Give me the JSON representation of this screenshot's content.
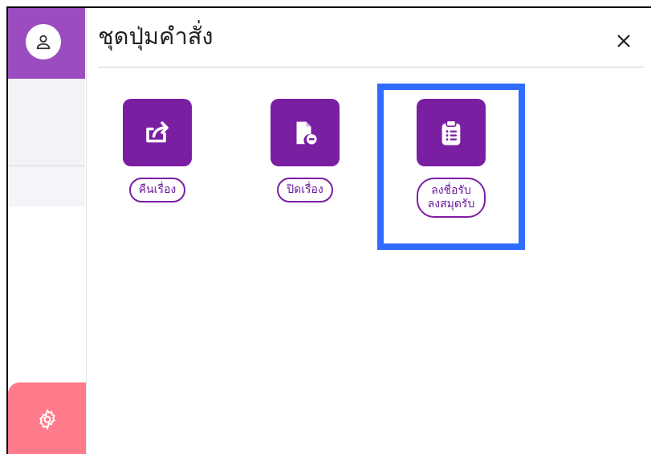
{
  "panel": {
    "title": "ชุดปุ่มคำสั่ง",
    "close_label": "×"
  },
  "commands": [
    {
      "label": "คืนเรื่อง",
      "icon": "share-return-icon"
    },
    {
      "label": "ปิดเรื่อง",
      "icon": "file-remove-icon"
    },
    {
      "label_line1": "ลงชื่อรับ",
      "label_line2": "ลงสมุดรับ",
      "icon": "clipboard-list-icon",
      "highlighted": true
    }
  ],
  "sidebar": {
    "avatar_icon": "user-icon",
    "settings_icon": "gear-icon"
  },
  "colors": {
    "sidebar_header": "#9b4dc0",
    "tile": "#7b1fa2",
    "settings_button": "#ff7a8a",
    "highlight": "#2f6cff"
  }
}
